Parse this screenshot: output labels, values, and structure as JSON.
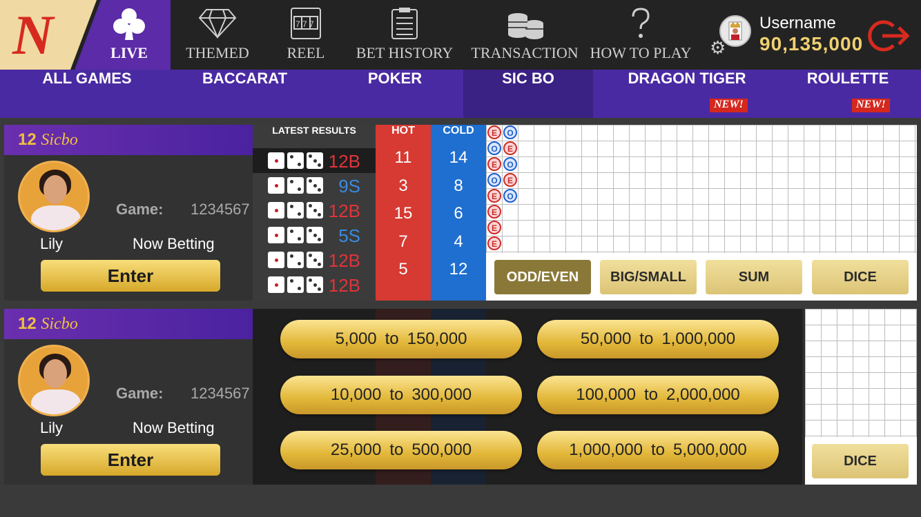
{
  "nav": {
    "logo": "N",
    "items": [
      {
        "label": "LIVE"
      },
      {
        "label": "THEMED"
      },
      {
        "label": "REEL"
      },
      {
        "label": "BET HISTORY"
      },
      {
        "label": "TRANSACTION"
      },
      {
        "label": "HOW TO PLAY"
      }
    ]
  },
  "user": {
    "name": "Username",
    "balance": "90,135,000"
  },
  "categories": [
    {
      "label": "ALL GAMES"
    },
    {
      "label": "BACCARAT"
    },
    {
      "label": "POKER"
    },
    {
      "label": "SIC BO"
    },
    {
      "label": "DRAGON TIGER",
      "badge": "NEW!"
    },
    {
      "label": "ROULETTE",
      "badge": "NEW!"
    }
  ],
  "tables": [
    {
      "number": "12",
      "name": "Sicbo",
      "dealer": "Lily",
      "game_label": "Game:",
      "game_id": "1234567",
      "status": "Now Betting",
      "enter_label": "Enter",
      "latest_results_label": "LATEST RESULTS",
      "results": [
        "12B",
        "9S",
        "12B",
        "5S",
        "12B",
        "12B"
      ],
      "hot_label": "HOT",
      "hot": [
        "11",
        "3",
        "15",
        "7",
        "5"
      ],
      "cold_label": "COLD",
      "cold": [
        "14",
        "8",
        "6",
        "4",
        "12"
      ],
      "road_tabs": [
        "ODD/EVEN",
        "BIG/SMALL",
        "SUM",
        "DICE"
      ]
    },
    {
      "number": "12",
      "name": "Sicbo",
      "dealer": "Lily",
      "game_label": "Game:",
      "game_id": "1234567",
      "status": "Now Betting",
      "enter_label": "Enter",
      "road_tabs": [
        "DICE"
      ]
    }
  ],
  "bet_ranges": [
    {
      "min": "5,000",
      "to": "to",
      "max": "150,000"
    },
    {
      "min": "50,000",
      "to": "to",
      "max": "1,000,000"
    },
    {
      "min": "10,000",
      "to": "to",
      "max": "300,000"
    },
    {
      "min": "100,000",
      "to": "to",
      "max": "2,000,000"
    },
    {
      "min": "25,000",
      "to": "to",
      "max": "500,000"
    },
    {
      "min": "1,000,000",
      "to": "to",
      "max": "5,000,000"
    }
  ],
  "colors": {
    "brand": "#d72a1f",
    "nav_active": "#5b2ba8",
    "category_bar": "#4a2aa2",
    "hot": "#d63a32",
    "cold": "#1e6fd0",
    "gold": "#f0c040"
  }
}
